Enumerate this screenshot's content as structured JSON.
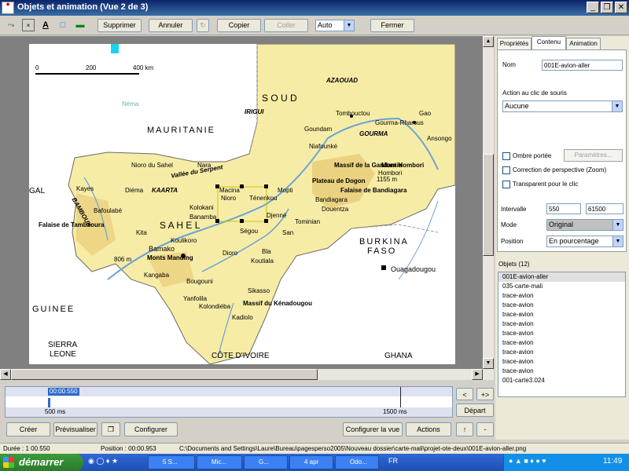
{
  "window": {
    "title": "Objets et animation  (Vue 2 de 3)",
    "title_icon": "app-icon",
    "controls": [
      "_",
      "❒",
      "✕"
    ]
  },
  "toolbar": {
    "tools": [
      "⤳",
      "×",
      "A",
      "□",
      "▬"
    ],
    "supprimer": "Supprimer",
    "annuler": "Annuler",
    "copier": "Copier",
    "coller": "Coller",
    "zoom": "Auto",
    "fermer": "Fermer"
  },
  "map": {
    "scale_labels": [
      "0",
      "200",
      "400 km"
    ],
    "countries": {
      "mauritanie": "MAURITANIE",
      "burkina": "BURKINA",
      "faso": "FASO",
      "guinee": "GUINEE",
      "sierra": "SIERRA",
      "leone": "LEONE",
      "cote_divoire": "CÔTE D'IVOIRE",
      "ghana": "GHANA",
      "gal": "GAL"
    },
    "regions": {
      "soud": "S    O    U    D",
      "sahel": "S    A    H    E    L",
      "azaouad": "AZAOUAD",
      "irigui": "IRIGUI",
      "gourma": "GOURMA",
      "kaarta": "KAARTA",
      "bambouk": "BAMBOUK",
      "vallee": "Vallée du Serpent"
    },
    "places": [
      "Tombouctou",
      "Gourma-Rharous",
      "Gao",
      "Nioro du Sahel",
      "Nara",
      "Kayes",
      "Diéma",
      "Bafoulabé",
      "Kita",
      "Bamako",
      "Koulikoro",
      "Ségou",
      "Mopti",
      "Djenné",
      "San",
      "Sikasso",
      "Bougouni",
      "Kangaba",
      "Koutiala",
      "Kolondiéba",
      "Kadiolo",
      "Yanfolila",
      "Niafounké",
      "Bandiagara",
      "Douentza",
      "Hombori",
      "Ouagadougou",
      "Kolokani",
      "Banamba",
      "Massif de la Gandamia",
      "Plateau de Dogon",
      "Falaise de Bandiagara",
      "Monts Manding",
      "Massif du Kénadougou",
      "Falaise de Tambaoura",
      "Mont Hombori",
      "1155 m",
      "806 m",
      "Goundam",
      "Ansongo",
      "Néma",
      "Ténenkou",
      "Macina",
      "Nioro",
      "Bla",
      "Dioro",
      "Tominian"
    ]
  },
  "panel": {
    "tabs": [
      "Propriétés",
      "Contenu",
      "Animation"
    ],
    "nom_label": "Nom",
    "nom_value": "001E-avion-aller",
    "action_label": "Action au clic de souris",
    "action_value": "Aucune",
    "ombre_label": "Ombre portée",
    "parametres": "Paramètres...",
    "correction_label": "Correction de perspective (Zoom)",
    "transparent_label": "Transparent pour le clic",
    "intervalle_label": "Intervalle",
    "intervalle_start": "550",
    "intervalle_end": "61500",
    "mode_label": "Mode",
    "mode_value": "Original",
    "position_label": "Position",
    "position_value": "En pourcentage",
    "objets_label": "Objets (12)",
    "objets": [
      "001E-avion-aller",
      "035-carte-mali",
      "trace-avion",
      "trace-avion",
      "trace-avion",
      "trace-avion",
      "trace-avion",
      "trace-avion",
      "trace-avion",
      "trace-avion",
      "trace-avion",
      "001-carte3.024"
    ]
  },
  "timeline": {
    "current": "00:00.550",
    "start": "500 ms",
    "end": "1500 ms",
    "btn_prev": "<",
    "btn_add": "+>",
    "depart": "Départ"
  },
  "bottom": {
    "creer": "Créer",
    "previsualiser": "Prévisualiser",
    "configurer": "Configurer",
    "configurer_la_vue": "Configurer la vue",
    "actions": "Actions",
    "up": "↑",
    "down": "-"
  },
  "status": {
    "duree": "Durée : 1 00.550",
    "position": "Position : 00:00.953",
    "path": "C:\\Documents and Settings\\Laure\\Bureau\\pagesperso2005\\Nouveau dossier\\carte-mali\\projet-ote-deux\\001E-avion-aller.png"
  },
  "taskbar": {
    "start": "démarrer",
    "items": [
      "5 S...",
      "Mic...",
      "G...",
      "4 apr",
      "Odo...",
      "FR"
    ],
    "clock": "11:49"
  }
}
